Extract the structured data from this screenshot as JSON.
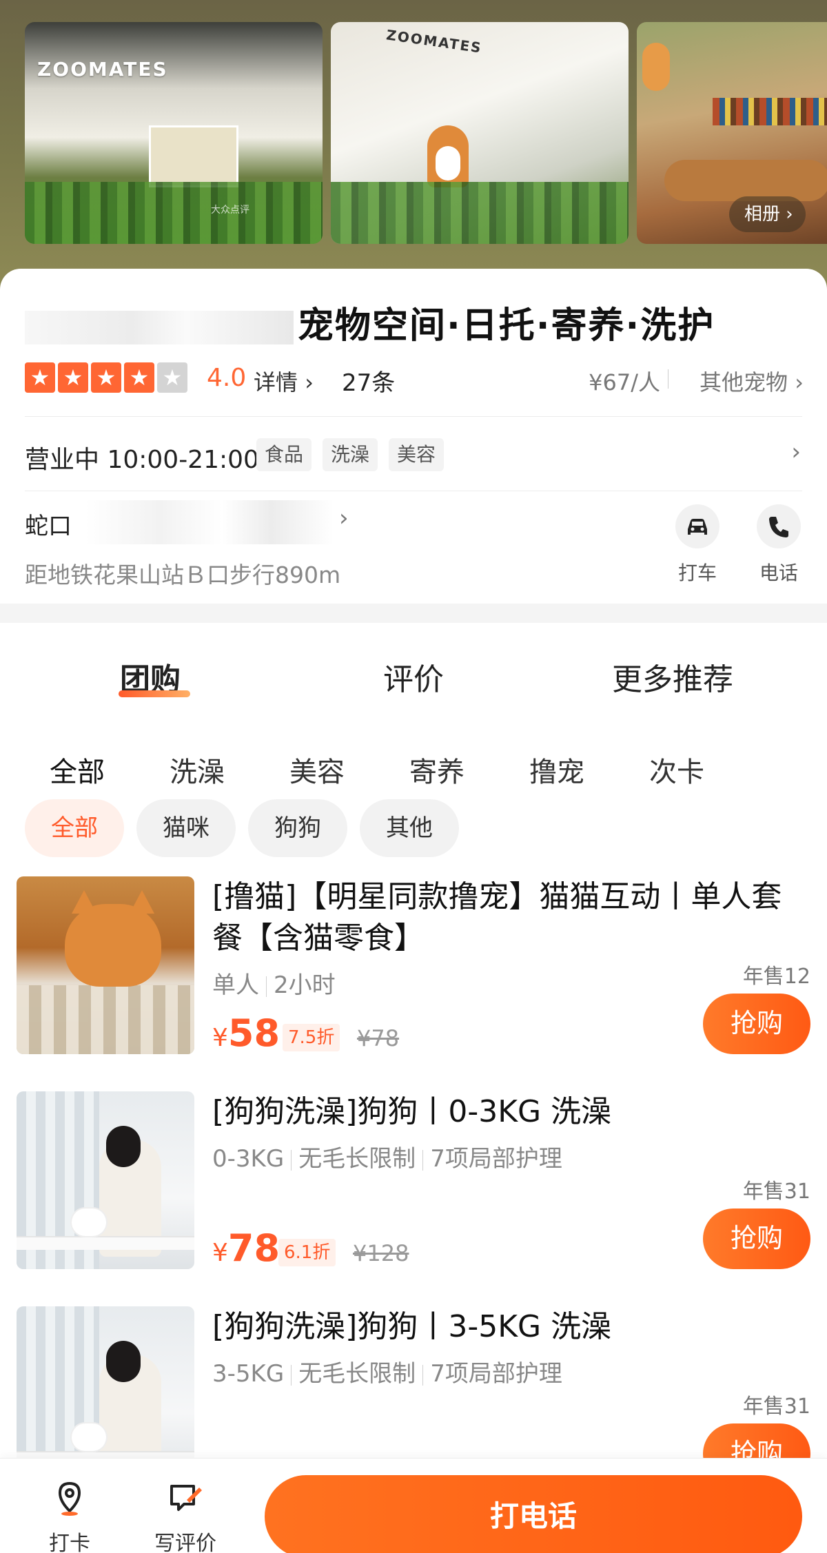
{
  "hero": {
    "photo1_sign": "ZOOMATES",
    "photo2_sign": "ZOOMATES",
    "watermark": "大众点评",
    "album_label": "相册",
    "album_chevron": "›"
  },
  "shop": {
    "name_visible": "宠物空间·日托·寄养·洗护",
    "rating": {
      "stars_filled": 4,
      "stars_total": 5,
      "score": "4.0",
      "detail_link": "详情",
      "review_count": "27条",
      "price_per_person": "¥67/人",
      "category": "其他宠物"
    },
    "hours": {
      "text": "营业中 10:00-21:00",
      "tags": [
        "食品",
        "洗澡",
        "美容"
      ]
    },
    "address": {
      "text": "蛇口",
      "metro": "距地铁花果山站Ｂ口步行890m"
    },
    "actions": [
      {
        "label": "打车",
        "icon": "car-icon"
      },
      {
        "label": "电话",
        "icon": "phone-icon"
      }
    ]
  },
  "tabs": {
    "items": [
      "团购",
      "评价",
      "更多推荐"
    ],
    "active": 0
  },
  "categories": {
    "items": [
      "全部",
      "洗澡",
      "美容",
      "寄养",
      "撸宠",
      "次卡"
    ],
    "active": 0
  },
  "chips": {
    "items": [
      "全部",
      "猫咪",
      "狗狗",
      "其他"
    ],
    "active": 0
  },
  "deals": [
    {
      "title": "[撸猫]【明星同款撸宠】猫猫互动丨单人套餐【含猫零食】",
      "sub": [
        "单人",
        "2小时"
      ],
      "sold": "年售12",
      "price_symbol": "¥",
      "price": "58",
      "discount": "7.5折",
      "original": "¥78",
      "buy_label": "抢购"
    },
    {
      "title": "[狗狗洗澡]狗狗丨0-3KG 洗澡",
      "sub": [
        "0-3KG",
        "无毛长限制",
        "7项局部护理"
      ],
      "sold": "年售31",
      "price_symbol": "¥",
      "price": "78",
      "discount": "6.1折",
      "original": "¥128",
      "buy_label": "抢购"
    },
    {
      "title": "[狗狗洗澡]狗狗丨3-5KG 洗澡",
      "sub": [
        "3-5KG",
        "无毛长限制",
        "7项局部护理"
      ],
      "sold": "年售31",
      "buy_label": "抢购"
    }
  ],
  "bottom_bar": {
    "checkin_label": "打卡",
    "review_label": "写评价",
    "call_label": "打电话"
  },
  "colors": {
    "accent": "#ff5a2a",
    "star": "#ff6633",
    "hero_bg": "#7c7a4c"
  }
}
